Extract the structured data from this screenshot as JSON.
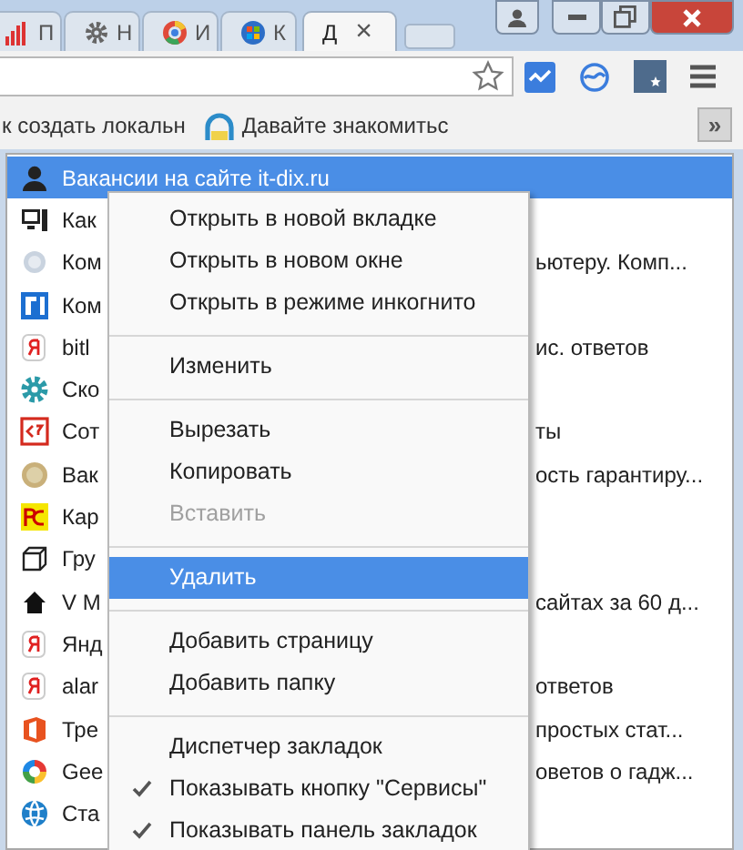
{
  "tabs": [
    {
      "label": "П",
      "selected": false
    },
    {
      "label": "Н",
      "selected": false
    },
    {
      "label": "И",
      "selected": false
    },
    {
      "label": "К",
      "selected": false
    },
    {
      "label": "Д",
      "selected": true,
      "close": "×"
    }
  ],
  "bookmarks_bar": {
    "items": [
      {
        "label": "к создать локальн"
      },
      {
        "label": "Давайте знакомитьс"
      }
    ],
    "overflow": "»"
  },
  "bookmark_list": [
    {
      "label": "Вакансии на сайте it-dix.ru",
      "selected": true
    },
    {
      "label": "Как",
      "selected": false
    },
    {
      "label": "Ком",
      "tail": "ьютеру. Комп...",
      "selected": false
    },
    {
      "label": "Ком",
      "selected": false
    },
    {
      "label": "bitl",
      "tail": "ис. ответов",
      "selected": false
    },
    {
      "label": "Ско",
      "selected": false
    },
    {
      "label": "Сот",
      "tail": "ты",
      "selected": false
    },
    {
      "label": "Вак",
      "tail": "ость гарантиру...",
      "selected": false
    },
    {
      "label": "Кар",
      "selected": false
    },
    {
      "label": "Гру",
      "selected": false
    },
    {
      "label": "V M",
      "tail": "сайтах за 60 д...",
      "selected": false
    },
    {
      "label": "Янд",
      "selected": false
    },
    {
      "label": "alar",
      "tail": "ответов",
      "selected": false
    },
    {
      "label": "Тре",
      "tail": "простых стат...",
      "selected": false
    },
    {
      "label": "Gee",
      "tail": "оветов о гадж...",
      "selected": false
    },
    {
      "label": "Ста",
      "selected": false
    }
  ],
  "context_menu": [
    {
      "kind": "item",
      "label": "Открыть в новой вкладке",
      "disabled": false,
      "selected": false,
      "checked": false
    },
    {
      "kind": "item",
      "label": "Открыть в новом окне",
      "disabled": false,
      "selected": false,
      "checked": false
    },
    {
      "kind": "item",
      "label": "Открыть в режиме инкогнито",
      "disabled": false,
      "selected": false,
      "checked": false
    },
    {
      "kind": "separator"
    },
    {
      "kind": "item",
      "label": "Изменить",
      "disabled": false,
      "selected": false,
      "checked": false
    },
    {
      "kind": "separator"
    },
    {
      "kind": "item",
      "label": "Вырезать",
      "disabled": false,
      "selected": false,
      "checked": false
    },
    {
      "kind": "item",
      "label": "Копировать",
      "disabled": false,
      "selected": false,
      "checked": false
    },
    {
      "kind": "item",
      "label": "Вставить",
      "disabled": true,
      "selected": false,
      "checked": false
    },
    {
      "kind": "separator"
    },
    {
      "kind": "item",
      "label": "Удалить",
      "disabled": false,
      "selected": true,
      "checked": false
    },
    {
      "kind": "separator"
    },
    {
      "kind": "item",
      "label": "Добавить страницу",
      "disabled": false,
      "selected": false,
      "checked": false
    },
    {
      "kind": "item",
      "label": "Добавить папку",
      "disabled": false,
      "selected": false,
      "checked": false
    },
    {
      "kind": "separator"
    },
    {
      "kind": "item",
      "label": "Диспетчер закладок",
      "disabled": false,
      "selected": false,
      "checked": false
    },
    {
      "kind": "item",
      "label": "Показывать кнопку \"Сервисы\"",
      "disabled": false,
      "selected": false,
      "checked": true
    },
    {
      "kind": "item",
      "label": "Показывать панель закладок",
      "disabled": false,
      "selected": false,
      "checked": true
    }
  ]
}
